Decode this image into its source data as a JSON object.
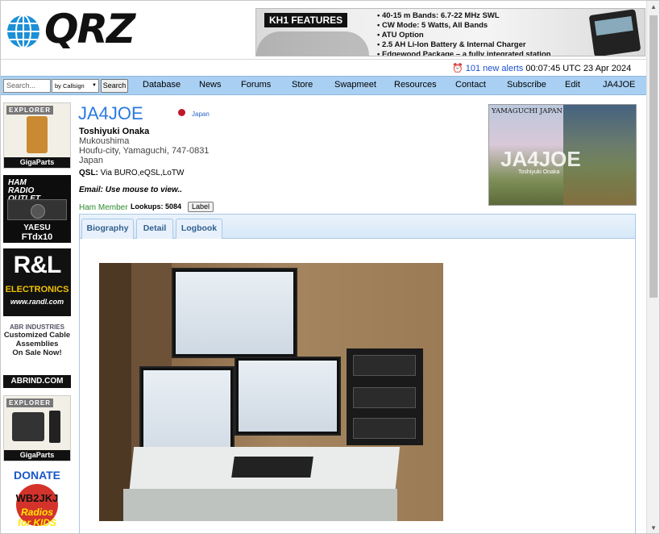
{
  "header": {
    "logo_text": "QRZ",
    "banner": {
      "title": "KH1 FEATURES",
      "features": [
        "40-15 m Bands: 6.7-22 MHz SWL",
        "CW Mode: 5 Watts, All Bands",
        "ATU Option",
        "2.5 AH Li-Ion Battery & Internal Charger",
        "Edgewood Package – a fully integrated station"
      ]
    },
    "alerts": "101 new alerts",
    "datetime": "00:07:45 UTC 23 Apr 2024"
  },
  "search": {
    "placeholder": "Search...",
    "select_value": "by Callsign",
    "button_label": "Search"
  },
  "nav": {
    "items": [
      "Database",
      "News",
      "Forums",
      "Store",
      "Swapmeet",
      "Resources",
      "Contact",
      "Subscribe",
      "Edit",
      "JA4JOE"
    ]
  },
  "ads": {
    "ad1": {
      "tag": "EXPLORER",
      "brand": "GigaParts"
    },
    "ad2": {
      "line1": "HAM",
      "line2": "RADIO",
      "line3": "OUTLET",
      "brand": "YAESU",
      "model": "FTdx10"
    },
    "ad3": {
      "logo": "R&L",
      "name": "ELECTRONICS",
      "url": "www.randl.com"
    },
    "ad4": {
      "company": "ABR INDUSTRIES",
      "line1": "Customized Cable",
      "line2": "Assemblies",
      "line3": "On Sale Now!",
      "url": "ABRIND.COM"
    },
    "ad5": {
      "tag": "EXPLORER",
      "brand": "GigaParts"
    },
    "ad6": {
      "donate": "DONATE",
      "callsign": "WB2JKJ",
      "line1": "Radios",
      "line2": "for KIDS"
    }
  },
  "profile": {
    "callsign": "JA4JOE",
    "country_flag": "Japan",
    "name": "Toshiyuki Onaka",
    "address": [
      "Mukoushima",
      "Houfu-city, Yamaguchi, 747-0831",
      "Japan"
    ],
    "qsl_label": "QSL:",
    "qsl_value": "Via BURO,eQSL,LoTW",
    "email": "Email: Use mouse to view..",
    "membership": "Ham Member",
    "lookups_label": "Lookups:",
    "lookups_value": "5084",
    "label_button": "Label"
  },
  "qsl_card": {
    "location": "YAMAGUCHI JAPAN",
    "big_call": "JA4JOE",
    "small_name": "Toshiyuki Onaka"
  },
  "tabs": [
    {
      "label": "Biography"
    },
    {
      "label": "Detail"
    },
    {
      "label": "Logbook"
    }
  ],
  "colors": {
    "nav_bg": "#a9d0f3",
    "callsign": "#2a7ae0",
    "ham_member": "#2a8a2a",
    "alerts_link": "#1a4fd0"
  }
}
